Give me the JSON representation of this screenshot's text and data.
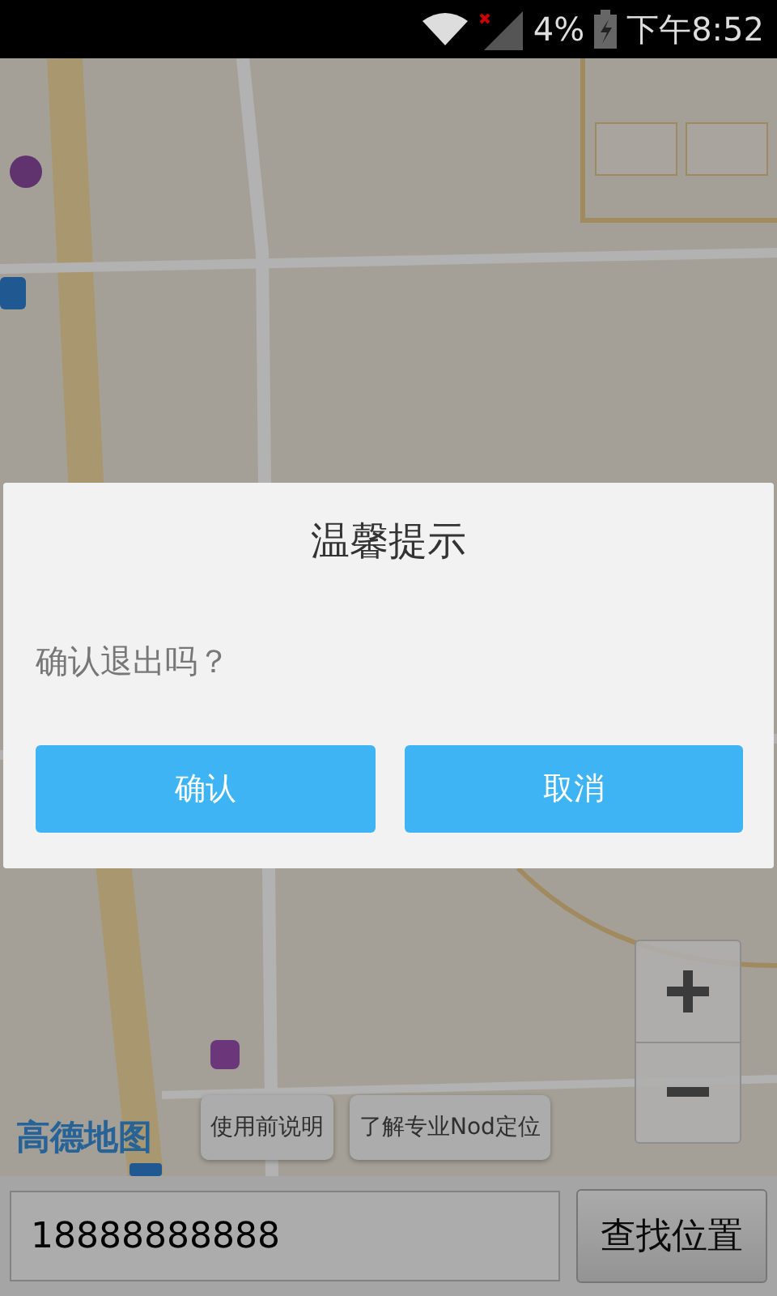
{
  "status_bar": {
    "battery": "4%",
    "time": "下午8:52"
  },
  "map": {
    "kind": "picture",
    "logo": "高德地图",
    "hint_buttons": [
      "使用前说明",
      "了解专业Nod定位"
    ]
  },
  "search": {
    "value": "18888888888",
    "button": "查找位置"
  },
  "dialog": {
    "title": "温馨提示",
    "message": "确认退出吗？",
    "buttons": [
      "确认",
      "取消"
    ]
  }
}
